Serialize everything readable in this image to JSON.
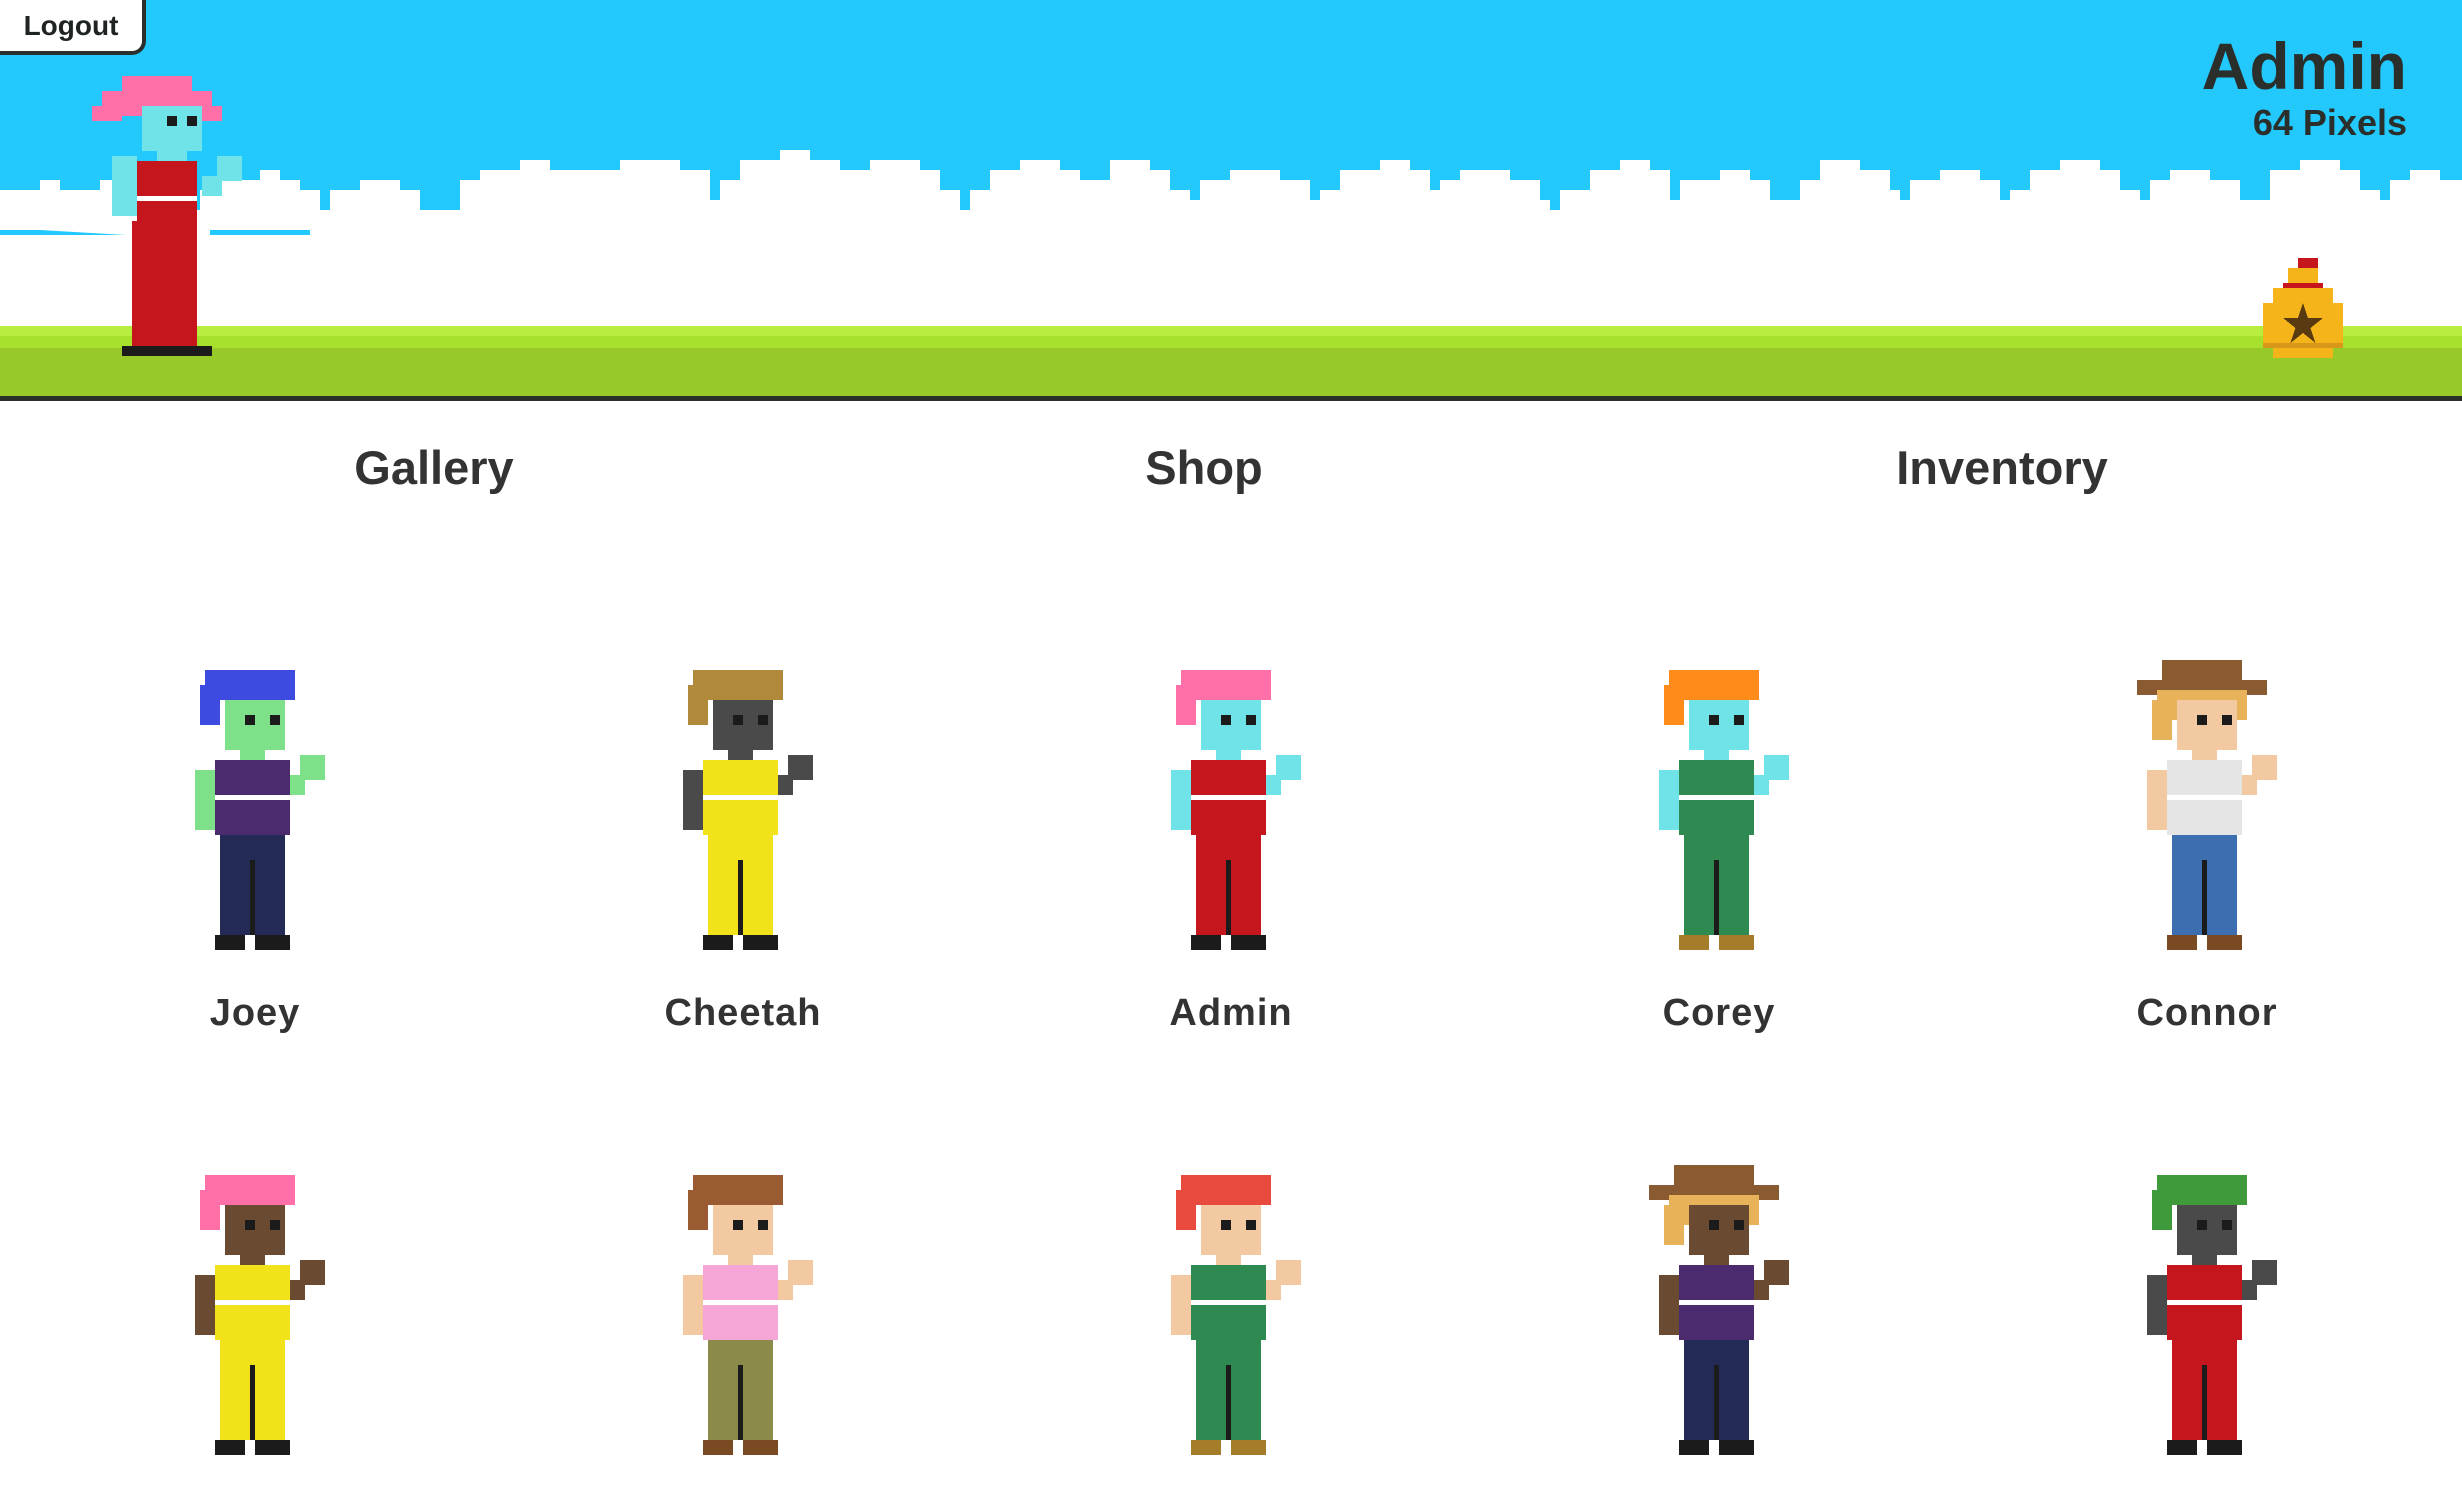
{
  "header": {
    "logout_label": "Logout",
    "user_name": "Admin",
    "pixels": "64 Pixels"
  },
  "nav": {
    "gallery": "Gallery",
    "shop": "Shop",
    "inventory": "Inventory"
  },
  "colors": {
    "sky": "#23c9fc",
    "grass": "#a7e02d",
    "bag": "#f4b41a"
  },
  "characters": [
    {
      "name": "Joey",
      "hair": "#3e4be0",
      "skin": "#7fe08a",
      "top": "#4b2a6e",
      "pants": "#232a55",
      "shoes": "#1b1b1b",
      "hat": ""
    },
    {
      "name": "Cheetah",
      "hair": "#b08a3a",
      "skin": "#4a4a4a",
      "top": "#f2e21a",
      "pants": "#f2e21a",
      "shoes": "#1b1b1b",
      "hat": ""
    },
    {
      "name": "Admin",
      "hair": "#ff6fa8",
      "skin": "#6fe3e8",
      "top": "#c4161c",
      "pants": "#c4161c",
      "shoes": "#1b1b1b",
      "hat": ""
    },
    {
      "name": "Corey",
      "hair": "#ff8c1a",
      "skin": "#6fe3e8",
      "top": "#2f8a52",
      "pants": "#2f8a52",
      "shoes": "#a57c2a",
      "hat": ""
    },
    {
      "name": "Connor",
      "hair": "#e8b25a",
      "skin": "#f2c9a0",
      "top": "#e5e5e5",
      "pants": "#3d6fb0",
      "shoes": "#7a4a22",
      "hat": "#8a5a30"
    },
    {
      "name": "",
      "hair": "#ff6fa8",
      "skin": "#6b4a32",
      "top": "#f2e21a",
      "pants": "#f2e21a",
      "shoes": "#1b1b1b",
      "hat": ""
    },
    {
      "name": "",
      "hair": "#9a5a32",
      "skin": "#f2c9a0",
      "top": "#f6a6d6",
      "pants": "#8a8a4a",
      "shoes": "#7a4a22",
      "hat": ""
    },
    {
      "name": "",
      "hair": "#e84a3e",
      "skin": "#f2c9a0",
      "top": "#2f8a52",
      "pants": "#2f8a52",
      "shoes": "#a57c2a",
      "hat": ""
    },
    {
      "name": "",
      "hair": "#e8b25a",
      "skin": "#6b4a32",
      "top": "#4b2a6e",
      "pants": "#232a55",
      "shoes": "#1b1b1b",
      "hat": "#8a5a30"
    },
    {
      "name": "",
      "hair": "#3e9a3a",
      "skin": "#4a4a4a",
      "top": "#c4161c",
      "pants": "#c4161c",
      "shoes": "#1b1b1b",
      "hat": ""
    }
  ]
}
